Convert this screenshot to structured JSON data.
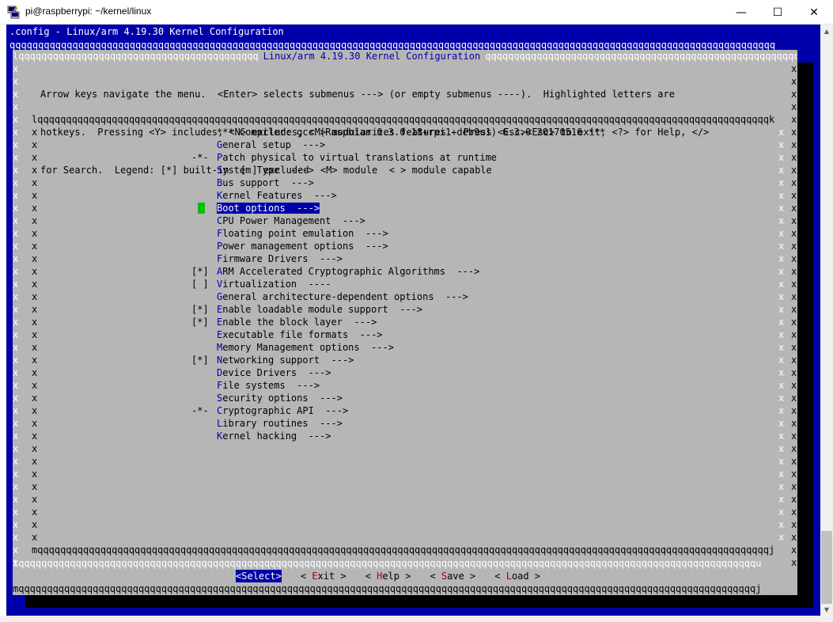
{
  "window": {
    "title": "pi@raspberrypi: ~/kernel/linux",
    "minimize": "—",
    "maximize": "☐",
    "close": "✕"
  },
  "terminal": {
    "header": ".config - Linux/arm 4.19.30 Kernel Configuration",
    "dialog_title": "Linux/arm 4.19.30 Kernel Configuration",
    "help_lines": [
      "Arrow keys navigate the menu.  <Enter> selects submenus ---> (or empty submenus ----).  Highlighted letters are",
      "hotkeys.  Pressing <Y> includes, <N> excludes, <M> modularizes features.  Press <Esc><Esc> to exit, <?> for Help, </>",
      "for Search.  Legend: [*] built-in  [ ] excluded  <M> module  < > module capable"
    ],
    "menu": [
      {
        "prefix": "",
        "hot": "",
        "rest": "*** Compiler: gcc (Raspbian 6.3.0-18+rpi1+deb9u1) 6.3.0 20170516 ***",
        "selected": false
      },
      {
        "prefix": "",
        "hot": "G",
        "rest": "eneral setup  --->",
        "selected": false
      },
      {
        "prefix": "-*-",
        "hot": "P",
        "rest": "atch physical to virtual translations at runtime",
        "selected": false
      },
      {
        "prefix": "",
        "hot": "S",
        "rest": "ystem Type  --->",
        "selected": false
      },
      {
        "prefix": "",
        "hot": "B",
        "rest": "us support  --->",
        "selected": false
      },
      {
        "prefix": "",
        "hot": "K",
        "rest": "ernel Features  --->",
        "selected": false
      },
      {
        "prefix": "",
        "hot": "B",
        "rest": "oot options  --->",
        "selected": true
      },
      {
        "prefix": "",
        "hot": "C",
        "rest": "PU Power Management  --->",
        "selected": false
      },
      {
        "prefix": "",
        "hot": "F",
        "rest": "loating point emulation  --->",
        "selected": false
      },
      {
        "prefix": "",
        "hot": "P",
        "rest": "ower management options  --->",
        "selected": false
      },
      {
        "prefix": "",
        "hot": "F",
        "rest": "irmware Drivers  --->",
        "selected": false
      },
      {
        "prefix": "[*]",
        "hot": "A",
        "rest": "RM Accelerated Cryptographic Algorithms  --->",
        "selected": false
      },
      {
        "prefix": "[ ]",
        "hot": "V",
        "rest": "irtualization  ----",
        "selected": false
      },
      {
        "prefix": "",
        "hot": "G",
        "rest": "eneral architecture-dependent options  --->",
        "selected": false
      },
      {
        "prefix": "[*]",
        "hot": "E",
        "rest": "nable loadable module support  --->",
        "selected": false
      },
      {
        "prefix": "[*]",
        "hot": "E",
        "rest": "nable the block layer  --->",
        "selected": false
      },
      {
        "prefix": "",
        "hot": "E",
        "rest": "xecutable file formats  --->",
        "selected": false
      },
      {
        "prefix": "",
        "hot": "M",
        "rest": "emory Management options  --->",
        "selected": false
      },
      {
        "prefix": "[*]",
        "hot": "N",
        "rest": "etworking support  --->",
        "selected": false
      },
      {
        "prefix": "",
        "hot": "D",
        "rest": "evice Drivers  --->",
        "selected": false
      },
      {
        "prefix": "",
        "hot": "F",
        "rest": "ile systems  --->",
        "selected": false
      },
      {
        "prefix": "",
        "hot": "S",
        "rest": "ecurity options  --->",
        "selected": false
      },
      {
        "prefix": "-*-",
        "hot": "C",
        "rest": "ryptographic API  --->",
        "selected": false
      },
      {
        "prefix": "",
        "hot": "L",
        "rest": "ibrary routines  --->",
        "selected": false
      },
      {
        "prefix": "",
        "hot": "K",
        "rest": "ernel hacking  --->",
        "selected": false
      }
    ],
    "buttons": [
      {
        "pre": "<",
        "hk": "S",
        "post": "elect>",
        "active": true
      },
      {
        "pre": "< ",
        "hk": "E",
        "post": "xit >",
        "active": false
      },
      {
        "pre": "< ",
        "hk": "H",
        "post": "elp >",
        "active": false
      },
      {
        "pre": "< ",
        "hk": "S",
        "post": "ave >",
        "active": false
      },
      {
        "pre": "< ",
        "hk": "L",
        "post": "oad >",
        "active": false
      }
    ]
  },
  "colors": {
    "terminal_bg": "#0000aa",
    "dialog_bg": "#b6b6b6",
    "hotkey_menu": "#0000aa",
    "hotkey_button": "#aa0000",
    "cursor": "#00c000"
  }
}
